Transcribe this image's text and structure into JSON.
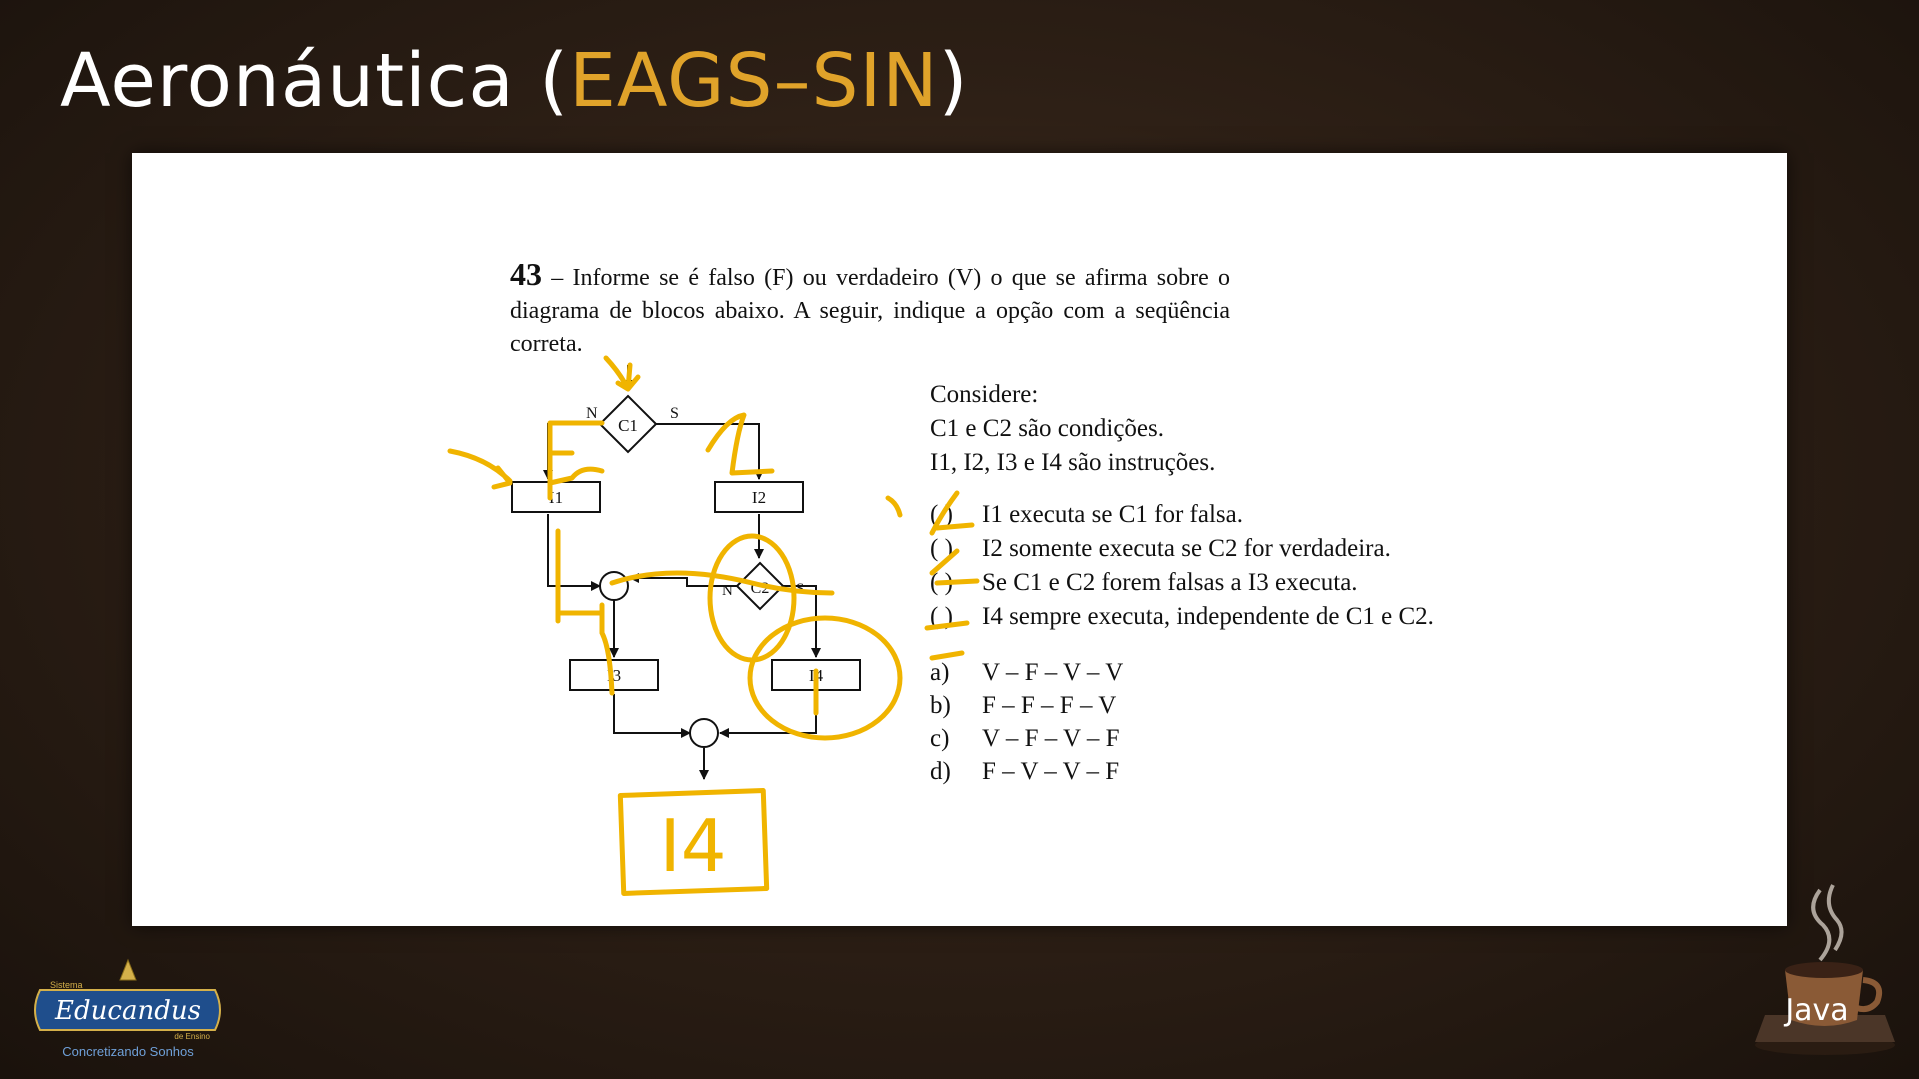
{
  "slide": {
    "title_prefix": "Aeronáutica (",
    "title_accent": "EAGS–SIN",
    "title_suffix": ")",
    "accent_color": "#e0a32a"
  },
  "question": {
    "number": "43",
    "text": "– Informe se é falso (F) ou verdadeiro (V) o que se afirma sobre o diagrama de blocos abaixo. A seguir, indique a opção com a seqüência correta."
  },
  "consider": {
    "heading": "Considere:",
    "line1": "C1 e C2 são condições.",
    "line2": "I1, I2, I3 e I4 são instruções."
  },
  "statements": [
    {
      "paren": "(   )",
      "text": "I1 executa se C1 for falsa."
    },
    {
      "paren": "(   )",
      "text": "I2 somente executa se C2 for verdadeira."
    },
    {
      "paren": "(   )",
      "text": "Se C1 e C2 forem falsas a I3 executa."
    },
    {
      "paren": "(   )",
      "text": "I4 sempre executa, independente de C1 e C2."
    }
  ],
  "options": [
    {
      "letter": "a)",
      "text": "V – F – V – V"
    },
    {
      "letter": "b)",
      "text": "F – F – F – V"
    },
    {
      "letter": "c)",
      "text": "V – F – V – F"
    },
    {
      "letter": "d)",
      "text": "F – V – V – F"
    }
  ],
  "diagram": {
    "c1": "C1",
    "c2": "C2",
    "n": "N",
    "s": "S",
    "i1": "I1",
    "i2": "I2",
    "i3": "I3",
    "i4": "I4"
  },
  "annotation": {
    "text": "I4",
    "color": "#f0b400"
  },
  "logos": {
    "left_top": "Sistema",
    "left_main": "Educandus",
    "left_sub": "de Ensino",
    "left_slogan": "Concretizando Sonhos",
    "right": "Java"
  }
}
